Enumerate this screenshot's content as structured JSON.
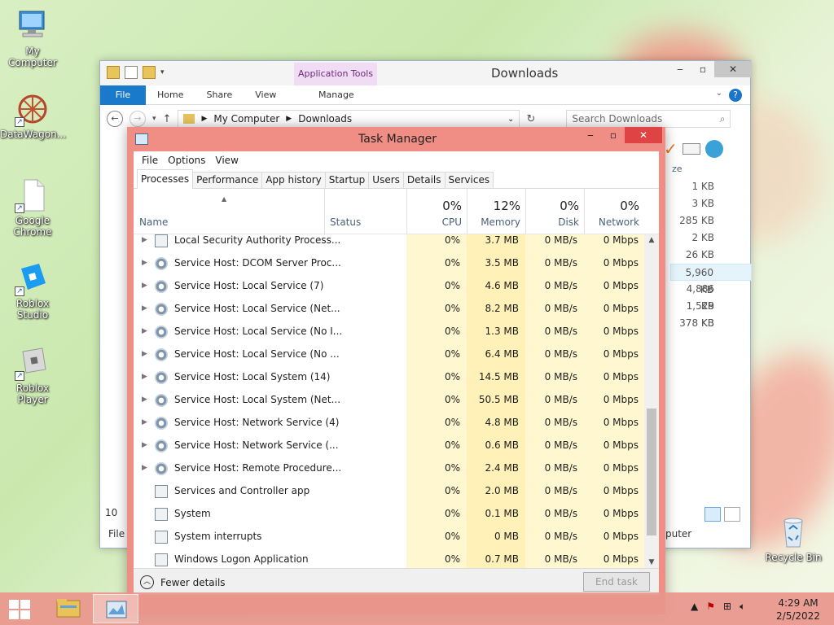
{
  "desktop": {
    "icons": [
      {
        "label": "My Computer"
      },
      {
        "label": "DataWagon..."
      },
      {
        "label": "Google Chrome"
      },
      {
        "label": "Roblox Studio"
      },
      {
        "label": "Roblox Player"
      },
      {
        "label": "Recycle Bin"
      }
    ]
  },
  "explorer": {
    "title": "Downloads",
    "contextual_tab_group": "Application Tools",
    "tabs": [
      "File",
      "Home",
      "Share",
      "View",
      "Manage"
    ],
    "breadcrumb": [
      "My Computer",
      "Downloads"
    ],
    "search_placeholder": "Search Downloads",
    "size_header_fragment": "ze",
    "sizes": [
      "1 KB",
      "3 KB",
      "285 KB",
      "2 KB",
      "26 KB",
      "5,960 KB",
      "4,886 KB",
      "1,529 KB",
      "378 KB"
    ],
    "selected_size_index": 5,
    "left_fragment": "10",
    "status_left_fragment": "File c",
    "status_right_fragment": "puter"
  },
  "task_manager": {
    "title": "Task Manager",
    "menu": [
      "File",
      "Options",
      "View"
    ],
    "tabs": [
      "Processes",
      "Performance",
      "App history",
      "Startup",
      "Users",
      "Details",
      "Services"
    ],
    "active_tab": "Processes",
    "columns": {
      "name": "Name",
      "status": "Status",
      "cpu": {
        "label": "CPU",
        "total": "0%"
      },
      "memory": {
        "label": "Memory",
        "total": "12%"
      },
      "disk": {
        "label": "Disk",
        "total": "0%"
      },
      "network": {
        "label": "Network",
        "total": "0%"
      }
    },
    "processes": [
      {
        "name": "Local Security Authority Process...",
        "icon": "box-icon",
        "expandable": true,
        "cpu": "0%",
        "memory": "3.7 MB",
        "disk": "0 MB/s",
        "network": "0 Mbps"
      },
      {
        "name": "Service Host: DCOM Server Proc...",
        "icon": "gear-icon",
        "expandable": true,
        "cpu": "0%",
        "memory": "3.5 MB",
        "disk": "0 MB/s",
        "network": "0 Mbps"
      },
      {
        "name": "Service Host: Local Service (7)",
        "icon": "gear-icon",
        "expandable": true,
        "cpu": "0%",
        "memory": "4.6 MB",
        "disk": "0 MB/s",
        "network": "0 Mbps"
      },
      {
        "name": "Service Host: Local Service (Net...",
        "icon": "gear-icon",
        "expandable": true,
        "cpu": "0%",
        "memory": "8.2 MB",
        "disk": "0 MB/s",
        "network": "0 Mbps"
      },
      {
        "name": "Service Host: Local Service (No I...",
        "icon": "gear-icon",
        "expandable": true,
        "cpu": "0%",
        "memory": "1.3 MB",
        "disk": "0 MB/s",
        "network": "0 Mbps"
      },
      {
        "name": "Service Host: Local Service (No ...",
        "icon": "gear-icon",
        "expandable": true,
        "cpu": "0%",
        "memory": "6.4 MB",
        "disk": "0 MB/s",
        "network": "0 Mbps"
      },
      {
        "name": "Service Host: Local System (14)",
        "icon": "gear-icon",
        "expandable": true,
        "cpu": "0%",
        "memory": "14.5 MB",
        "disk": "0 MB/s",
        "network": "0 Mbps"
      },
      {
        "name": "Service Host: Local System (Net...",
        "icon": "gear-icon",
        "expandable": true,
        "cpu": "0%",
        "memory": "50.5 MB",
        "disk": "0 MB/s",
        "network": "0 Mbps"
      },
      {
        "name": "Service Host: Network Service (4)",
        "icon": "gear-icon",
        "expandable": true,
        "cpu": "0%",
        "memory": "4.8 MB",
        "disk": "0 MB/s",
        "network": "0 Mbps"
      },
      {
        "name": "Service Host: Network Service (...",
        "icon": "gear-icon",
        "expandable": true,
        "cpu": "0%",
        "memory": "0.6 MB",
        "disk": "0 MB/s",
        "network": "0 Mbps"
      },
      {
        "name": "Service Host: Remote Procedure...",
        "icon": "gear-icon",
        "expandable": true,
        "cpu": "0%",
        "memory": "2.4 MB",
        "disk": "0 MB/s",
        "network": "0 Mbps"
      },
      {
        "name": "Services and Controller app",
        "icon": "box-icon",
        "expandable": false,
        "cpu": "0%",
        "memory": "2.0 MB",
        "disk": "0 MB/s",
        "network": "0 Mbps"
      },
      {
        "name": "System",
        "icon": "box-icon",
        "expandable": false,
        "cpu": "0%",
        "memory": "0.1 MB",
        "disk": "0 MB/s",
        "network": "0 Mbps"
      },
      {
        "name": "System interrupts",
        "icon": "box-icon",
        "expandable": false,
        "cpu": "0%",
        "memory": "0 MB",
        "disk": "0 MB/s",
        "network": "0 Mbps"
      },
      {
        "name": "Windows Logon Application",
        "icon": "box-icon",
        "expandable": false,
        "cpu": "0%",
        "memory": "0.7 MB",
        "disk": "0 MB/s",
        "network": "0 Mbps"
      }
    ],
    "fewer_details": "Fewer details",
    "end_task": "End task"
  },
  "taskbar": {
    "time": "4:29 AM",
    "date": "2/5/2022"
  },
  "colors": {
    "accent": "#1979ca",
    "taskbar": "#e9968c",
    "tm_frame": "#f08d84",
    "close_red": "#e04343"
  }
}
